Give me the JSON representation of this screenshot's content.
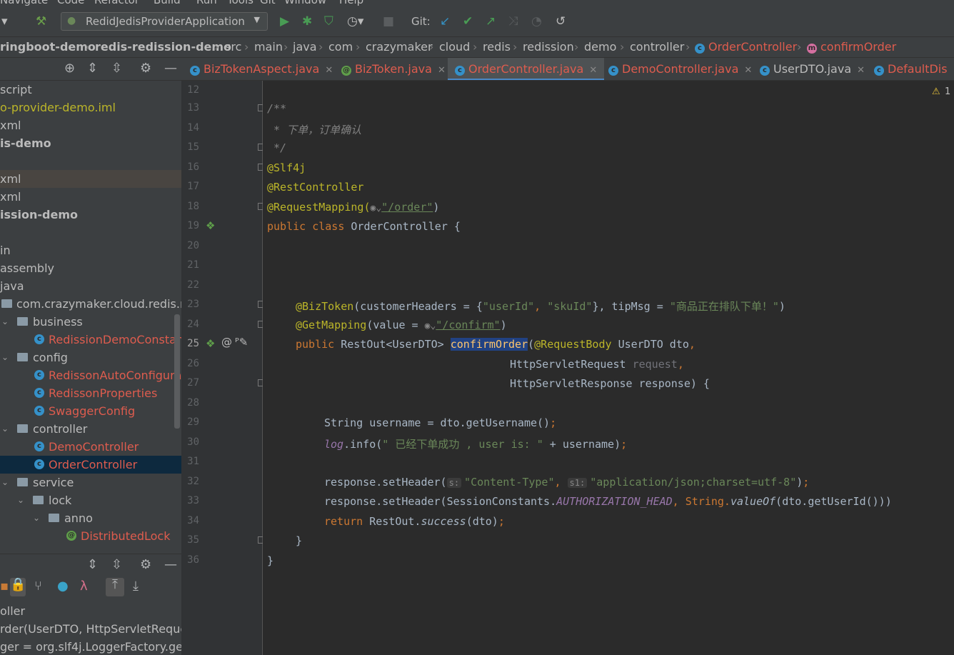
{
  "menu": [
    "Navigate",
    "Code",
    "Refactor",
    "Build",
    "Run",
    "Tools",
    "Git",
    "Window",
    "Help"
  ],
  "toolbar": {
    "run_config": "RedidJedisProviderApplication",
    "git_label": "Git:"
  },
  "breadcrumb": [
    "ringboot-demo",
    "redis-redission-demo",
    "src",
    "main",
    "java",
    "com",
    "crazymaker",
    "cloud",
    "redis",
    "redission",
    "demo",
    "controller",
    "OrderController",
    "confirmOrder"
  ],
  "project_tree": [
    {
      "text": "script"
    },
    {
      "text": "o-provider-demo.iml"
    },
    {
      "text": "xml"
    },
    {
      "text": "is-demo"
    },
    {
      "text": ""
    },
    {
      "text": "xml"
    },
    {
      "text": "ission-demo"
    },
    {
      "text": ""
    },
    {
      "text": "in"
    },
    {
      "text": "assembly"
    },
    {
      "text": "java"
    },
    {
      "text": "com.crazymaker.cloud.redis.red"
    },
    {
      "text": "business"
    },
    {
      "text": "RedissionDemoConstant"
    },
    {
      "text": "config"
    },
    {
      "text": "RedissonAutoConfiguratio"
    },
    {
      "text": "RedissonProperties"
    },
    {
      "text": "SwaggerConfig"
    },
    {
      "text": "controller"
    },
    {
      "text": "DemoController"
    },
    {
      "text": "OrderController"
    },
    {
      "text": "service"
    },
    {
      "text": "lock"
    },
    {
      "text": "anno"
    },
    {
      "text": "DistributedLock"
    }
  ],
  "structure": [
    "oller",
    "rder(UserDTO, HttpServletRequest",
    "ger = org.slf4j.LoggerFactory.getLo"
  ],
  "tabs": [
    {
      "label": "BizTokenAspect.java"
    },
    {
      "label": "BizToken.java"
    },
    {
      "label": "OrderController.java"
    },
    {
      "label": "DemoController.java"
    },
    {
      "label": "UserDTO.java"
    },
    {
      "label": "DefaultDis"
    }
  ],
  "editor": {
    "warning_count": "1",
    "line_numbers": [
      "12",
      "13",
      "14",
      "15",
      "16",
      "17",
      "18",
      "19",
      "20",
      "21",
      "22",
      "23",
      "24",
      "25",
      "26",
      "27",
      "28",
      "29",
      "30",
      "31",
      "32",
      "33",
      "34",
      "35",
      "36"
    ],
    "code": {
      "l13": "/**",
      "l14": " * 下单，订单确认",
      "l15": " */",
      "l16": "@Slf4j",
      "l17": "@RestController",
      "l18a": "@RequestMapping(",
      "l18b": "\"/order\"",
      "l18c": ")",
      "l19a": "public class ",
      "l19b": "OrderController {",
      "l23a": "@BizToken",
      "l23b": "(customerHeaders = {",
      "l23c": "\"userId\"",
      "l23d": ", ",
      "l23e": "\"skuId\"",
      "l23f": "}, tipMsg = ",
      "l23g": "\"商品正在排队下单！\"",
      "l23h": ")",
      "l24a": "@GetMapping",
      "l24b": "(value = ",
      "l24c": "\"/confirm\"",
      "l24d": ")",
      "l25a": "public ",
      "l25b": "RestOut<UserDTO> ",
      "l25c": "confirmOrder",
      "l25d": "(",
      "l25e": "@RequestBody ",
      "l25f": "UserDTO dto",
      "l25g": ",",
      "l26a": "HttpServletRequest ",
      "l26b": "request",
      "l26c": ",",
      "l27": "HttpServletResponse response) {",
      "l29a": "String username = dto.getUsername()",
      "l29b": ";",
      "l30a": "log",
      "l30b": ".info(",
      "l30c": "\" 已经下单成功 , user is: \"",
      "l30d": " + username)",
      "l30e": ";",
      "l32a": "response.setHeader(",
      "l32h1": "s:",
      "l32b": "\"Content-Type\"",
      "l32c": ", ",
      "l32h2": "s1:",
      "l32d": "\"application/json;charset=utf-8\"",
      "l32e": ")",
      "l32f": ";",
      "l33a": "response.setHeader(SessionConstants.",
      "l33b": "AUTHORIZATION_HEAD",
      "l33c": ", String.",
      "l33d": "valueOf",
      "l33e": "(dto.getUserId()))",
      "l34a": "return ",
      "l34b": "RestOut.",
      "l34c": "success",
      "l34d": "(dto)",
      "l34e": ";",
      "l35": "}",
      "l36": "}"
    }
  },
  "colors": {
    "accent": "#4a88c7",
    "class_red": "#de5c4e",
    "keyword": "#cc7832",
    "annotation": "#bbb529",
    "string": "#6a8759"
  }
}
